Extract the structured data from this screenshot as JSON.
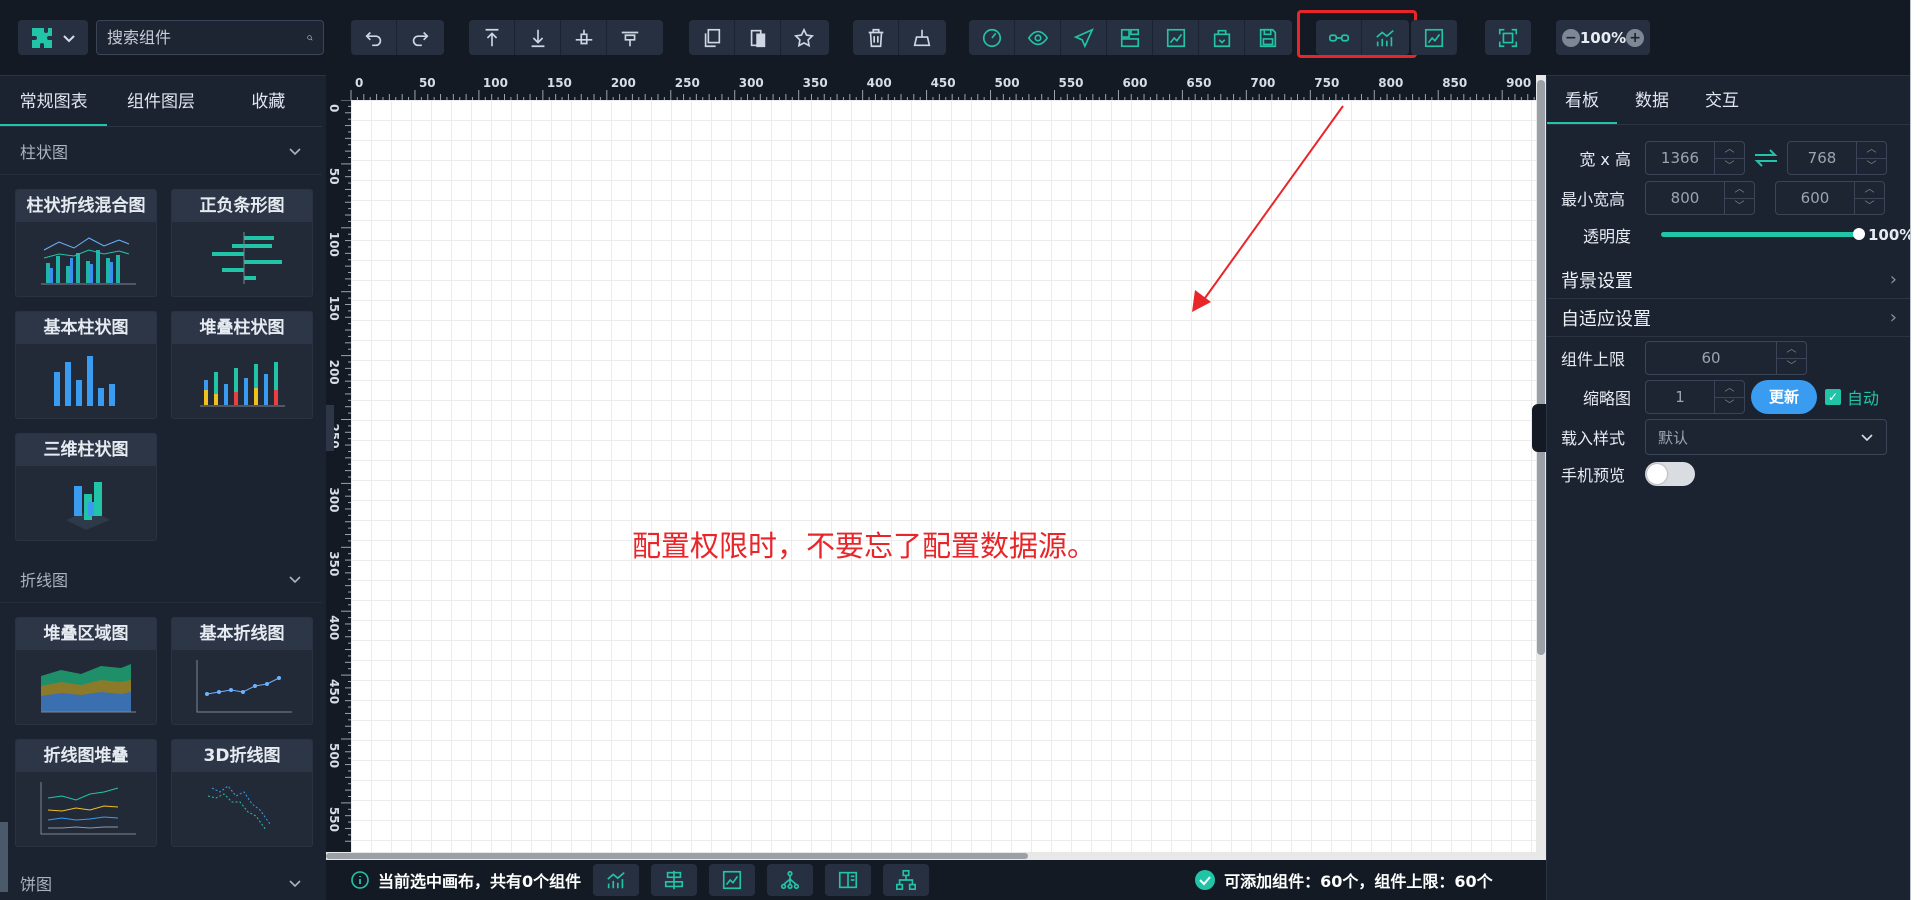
{
  "search": {
    "placeholder": "搜索组件"
  },
  "zoom": {
    "value": "100%"
  },
  "left_tabs": [
    "常规图表",
    "组件图层",
    "收藏"
  ],
  "sections": {
    "bar": "柱状图",
    "line": "折线图",
    "pie": "饼图"
  },
  "bar_cards": [
    "柱状折线混合图",
    "正负条形图",
    "基本柱状图",
    "堆叠柱状图",
    "三维柱状图"
  ],
  "line_cards": [
    "堆叠区域图",
    "基本折线图",
    "折线图堆叠",
    "3D折线图"
  ],
  "ruler": {
    "h": [
      "0",
      "50",
      "100",
      "150",
      "200",
      "250",
      "300",
      "350",
      "400",
      "450",
      "500",
      "550",
      "600",
      "650",
      "700",
      "750",
      "800",
      "850",
      "900"
    ],
    "v": [
      "0",
      "50",
      "100",
      "150",
      "200",
      "250",
      "300",
      "350",
      "400",
      "450",
      "500",
      "550"
    ]
  },
  "canvas_note": "配置权限时，不要忘了配置数据源。",
  "status": {
    "left": "当前选中画布，共有0个组件",
    "right": "可添加组件：60个，组件上限：60个"
  },
  "right_tabs": [
    "看板",
    "数据",
    "交互"
  ],
  "panel": {
    "size_label": "宽 x 高",
    "width": "1366",
    "height": "768",
    "min_label": "最小宽高",
    "min_width": "800",
    "min_height": "600",
    "opacity_label": "透明度",
    "opacity_value": "100%",
    "bg_label": "背景设置",
    "adapt_label": "自适应设置",
    "limit_label": "组件上限",
    "limit_value": "60",
    "thumb_label": "缩略图",
    "thumb_value": "1",
    "update_label": "更新",
    "auto_label": "自动",
    "load_label": "载入样式",
    "load_value": "默认",
    "mobile_label": "手机预览"
  },
  "colors": {
    "accent": "#22c4a8",
    "highlight": "#e8262a",
    "primary": "#3a9cf0"
  }
}
